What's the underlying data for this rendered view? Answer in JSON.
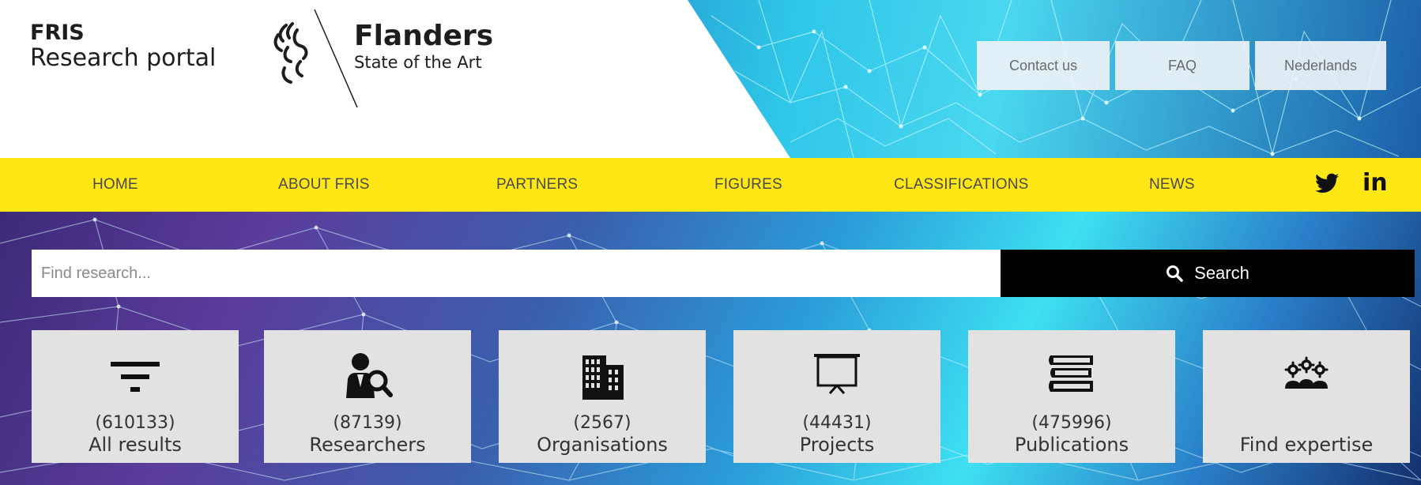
{
  "brand": {
    "fris_title": "FRIS",
    "fris_subtitle": "Research portal",
    "flanders_title": "Flanders",
    "flanders_subtitle": "State of the Art"
  },
  "top_links": {
    "contact": "Contact us",
    "faq": "FAQ",
    "language": "Nederlands"
  },
  "nav": {
    "items": [
      "HOME",
      "ABOUT FRIS",
      "PARTNERS",
      "FIGURES",
      "CLASSIFICATIONS",
      "NEWS"
    ],
    "social": {
      "twitter_icon": "twitter-icon",
      "linkedin_label": "in"
    },
    "background_color": "#ffe615"
  },
  "search": {
    "placeholder": "Find research...",
    "value": "",
    "button_label": "Search",
    "button_icon": "search-icon"
  },
  "tiles": [
    {
      "count": "(610133)",
      "label": "All results",
      "icon": "filter-icon"
    },
    {
      "count": "(87139)",
      "label": "Researchers",
      "icon": "researcher-search-icon"
    },
    {
      "count": "(2567)",
      "label": "Organisations",
      "icon": "buildings-icon"
    },
    {
      "count": "(44431)",
      "label": "Projects",
      "icon": "presentation-board-icon"
    },
    {
      "count": "(475996)",
      "label": "Publications",
      "icon": "books-icon"
    },
    {
      "count": "",
      "label": "Find expertise",
      "icon": "expertise-gears-icon"
    }
  ]
}
